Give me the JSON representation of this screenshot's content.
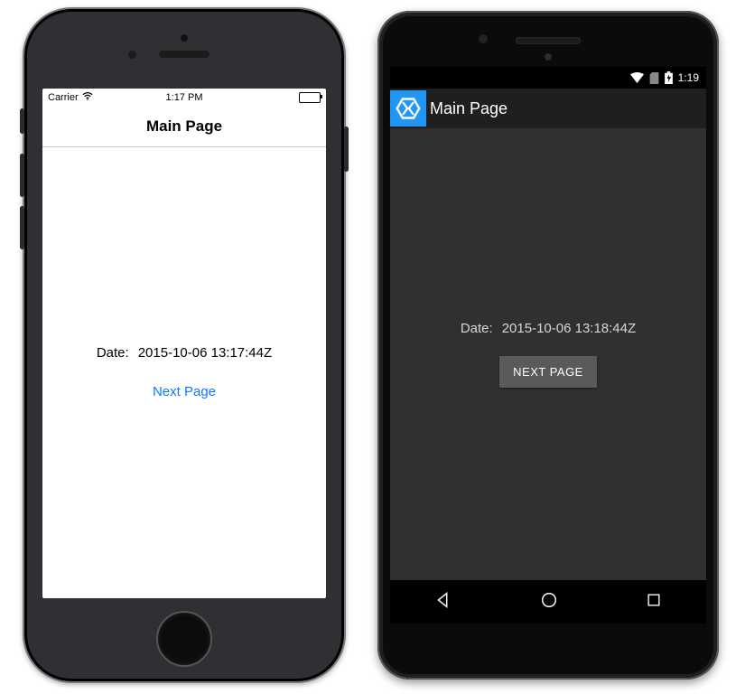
{
  "ios": {
    "statusbar": {
      "carrier": "Carrier",
      "time": "1:17 PM"
    },
    "navbar": {
      "title": "Main Page"
    },
    "body": {
      "date_label": "Date:",
      "date_value": "2015-10-06 13:17:44Z",
      "next_page_label": "Next Page"
    }
  },
  "android": {
    "statusbar": {
      "time": "1:19"
    },
    "appbar": {
      "title": "Main Page"
    },
    "body": {
      "date_label": "Date:",
      "date_value": "2015-10-06 13:18:44Z",
      "next_page_label": "NEXT PAGE"
    }
  }
}
